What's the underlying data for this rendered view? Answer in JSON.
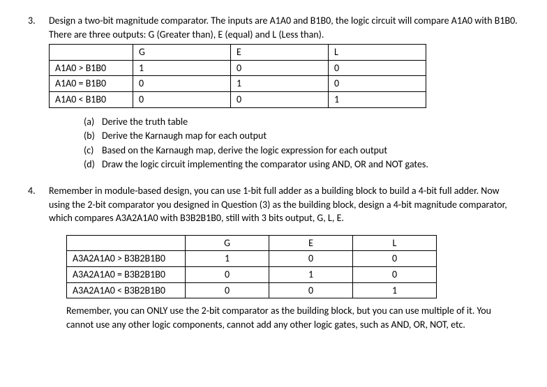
{
  "q3": {
    "num": "3.",
    "text": "Design a two-bit magnitude comparator. The inputs are A1A0 and B1B0, the logic circuit will compare A1A0 with B1B0. There are three outputs: G (Greater than), E (equal) and L (Less than).",
    "table": {
      "headers": [
        "",
        "G",
        "E",
        "L"
      ],
      "rows": [
        [
          "A1A0 > B1B0",
          "1",
          "0",
          "0"
        ],
        [
          "A1A0 = B1B0",
          "0",
          "1",
          "0"
        ],
        [
          "A1A0 < B1B0",
          "0",
          "0",
          "1"
        ]
      ]
    },
    "sub": {
      "a": {
        "label": "(a)",
        "text": "Derive the truth table"
      },
      "b": {
        "label": "(b)",
        "text": "Derive the Karnaugh map for each output"
      },
      "c": {
        "label": "(c)",
        "text": "Based on the Karnaugh map, derive the logic expression for each output"
      },
      "d": {
        "label": "(d)",
        "text": "Draw the logic circuit implementing the comparator using AND, OR and NOT gates."
      }
    }
  },
  "q4": {
    "num": "4.",
    "text": "Remember in module-based design, you can use 1-bit full adder as a building block to build a 4-bit full adder. Now using the 2-bit comparator you designed in Question (3) as the building block, design a 4-bit magnitude comparator, which compares A3A2A1A0 with B3B2B1B0, still with 3 bits output, G, L, E.",
    "table": {
      "headers": [
        "",
        "G",
        "E",
        "L"
      ],
      "rows": [
        [
          "A3A2A1A0 > B3B2B1B0",
          "1",
          "0",
          "0"
        ],
        [
          "A3A2A1A0 = B3B2B1B0",
          "0",
          "1",
          "0"
        ],
        [
          "A3A2A1A0 < B3B2B1B0",
          "0",
          "0",
          "1"
        ]
      ]
    },
    "note": "Remember, you can ONLY use the 2-bit comparator as the building block, but you can use multiple of it. You cannot use any other logic components, cannot add any other logic gates, such as AND, OR, NOT, etc."
  }
}
